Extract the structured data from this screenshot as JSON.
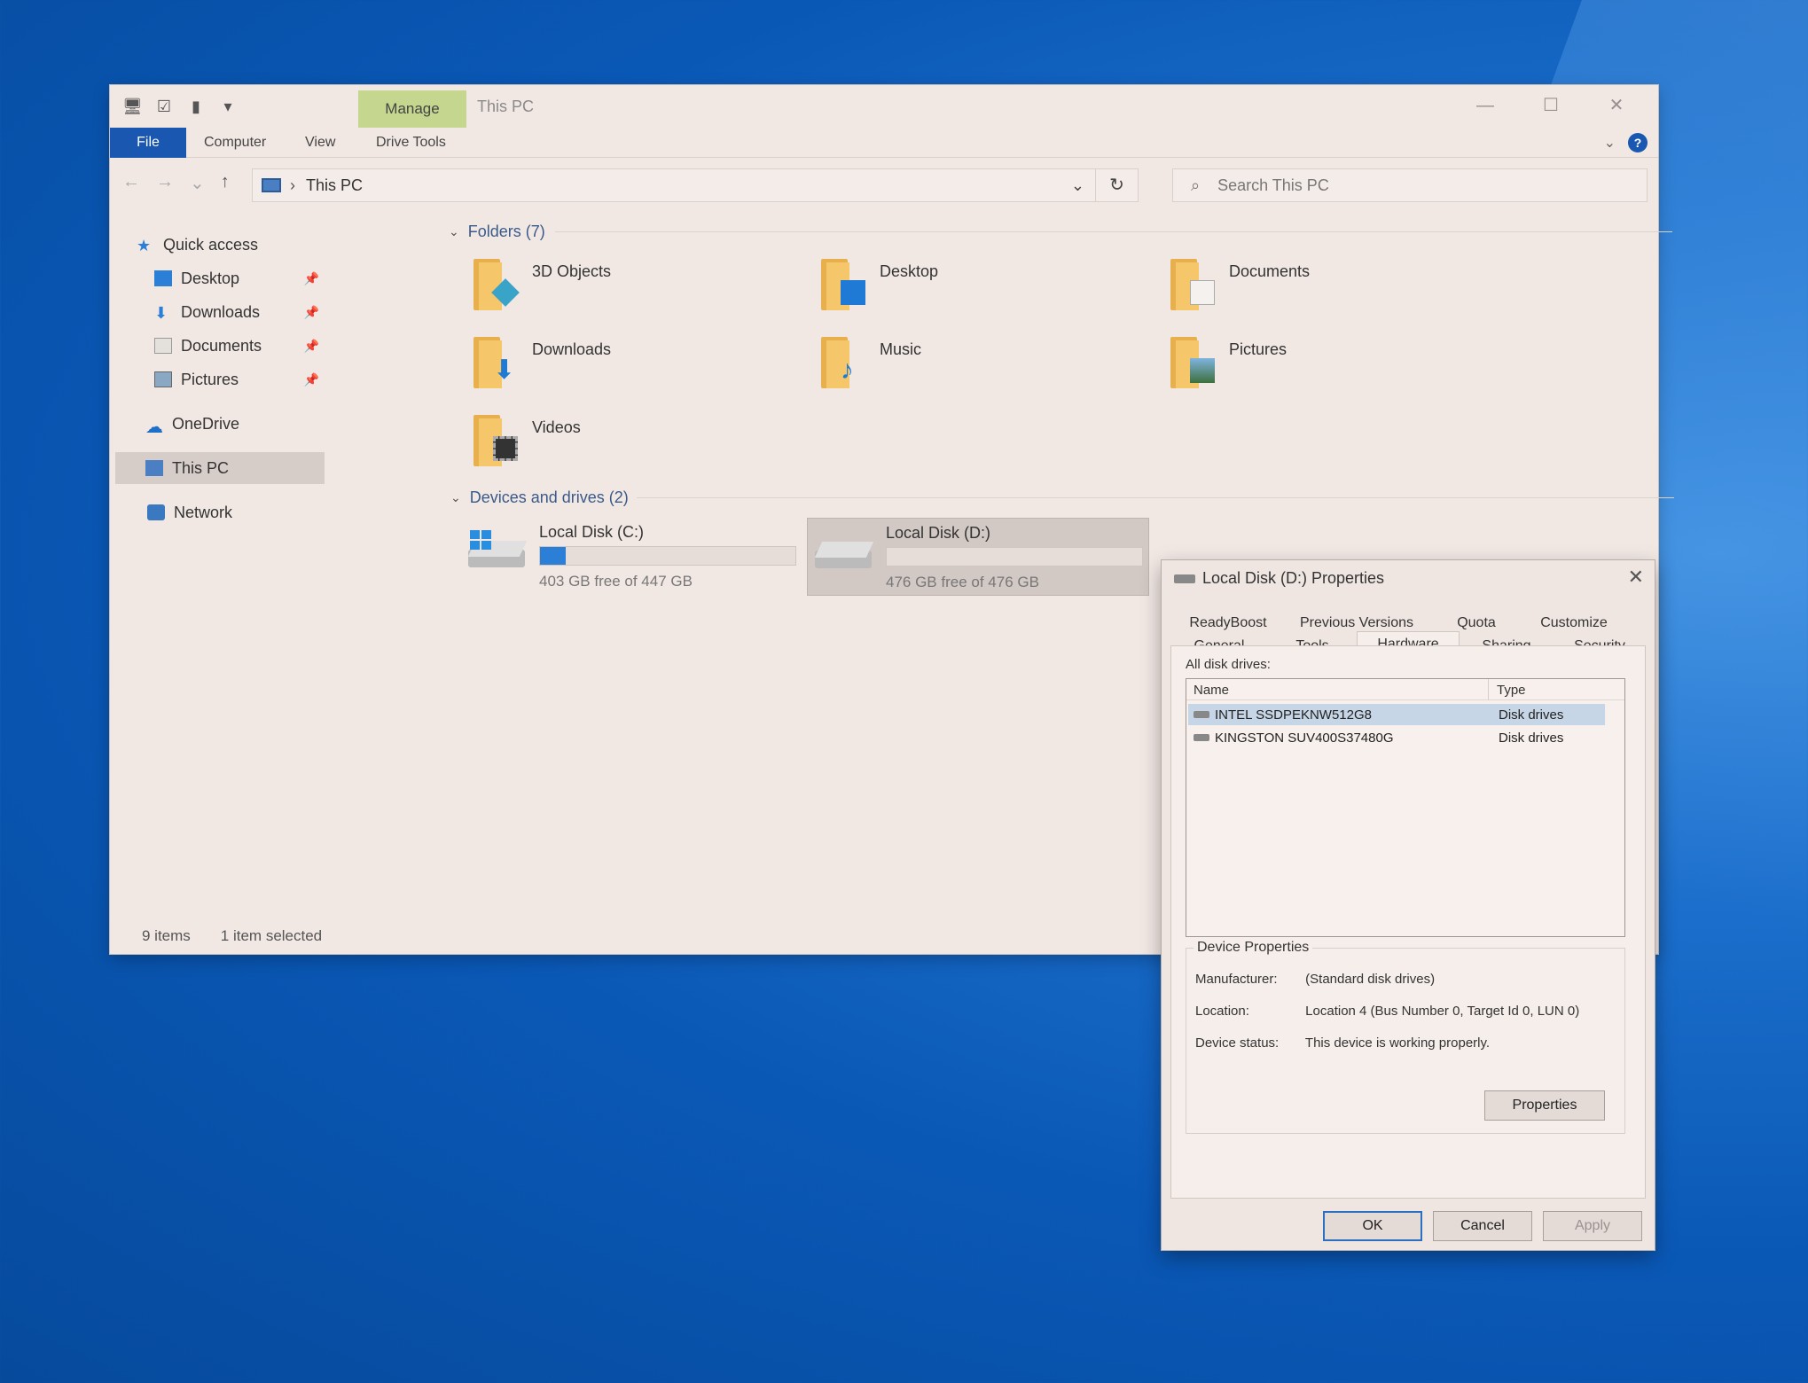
{
  "explorer": {
    "title": "This PC",
    "manage_tab": "Manage",
    "ribbon_tabs": {
      "file": "File",
      "computer": "Computer",
      "view": "View",
      "drive_tools": "Drive Tools"
    },
    "address": "This PC",
    "search_placeholder": "Search This PC",
    "sidebar": {
      "quick_access": "Quick access",
      "desktop": "Desktop",
      "downloads": "Downloads",
      "documents": "Documents",
      "pictures": "Pictures",
      "onedrive": "OneDrive",
      "this_pc": "This PC",
      "network": "Network"
    },
    "folders_header": "Folders (7)",
    "folders": [
      "3D Objects",
      "Desktop",
      "Documents",
      "Downloads",
      "Music",
      "Pictures",
      "Videos"
    ],
    "devices_header": "Devices and drives (2)",
    "drives": [
      {
        "name": "Local Disk (C:)",
        "free": "403 GB free of 447 GB",
        "used_fraction": 0.1
      },
      {
        "name": "Local Disk (D:)",
        "free": "476 GB free of 476 GB",
        "used_fraction": 0.0
      }
    ],
    "status": {
      "items": "9 items",
      "selected": "1 item selected"
    }
  },
  "dialog": {
    "title": "Local Disk (D:) Properties",
    "tabs_row1": [
      "ReadyBoost",
      "Previous Versions",
      "Quota",
      "Customize"
    ],
    "tabs_row2": [
      "General",
      "Tools",
      "Hardware",
      "Sharing",
      "Security"
    ],
    "all_drives_label": "All disk drives:",
    "columns": {
      "name": "Name",
      "type": "Type"
    },
    "drives": [
      {
        "name": "INTEL SSDPEKNW512G8",
        "type": "Disk drives"
      },
      {
        "name": "KINGSTON SUV400S37480G",
        "type": "Disk drives"
      }
    ],
    "device_properties_label": "Device Properties",
    "manufacturer_label": "Manufacturer:",
    "manufacturer": "(Standard disk drives)",
    "location_label": "Location:",
    "location": "Location 4 (Bus Number 0, Target Id 0, LUN 0)",
    "status_label": "Device status:",
    "status": "This device is working properly.",
    "properties_button": "Properties",
    "ok": "OK",
    "cancel": "Cancel",
    "apply": "Apply"
  },
  "colors": {
    "accent": "#1957b0",
    "manage_tab": "#c5d68e",
    "progress": "#2c7fd6",
    "desktop": "#0a58b6"
  }
}
